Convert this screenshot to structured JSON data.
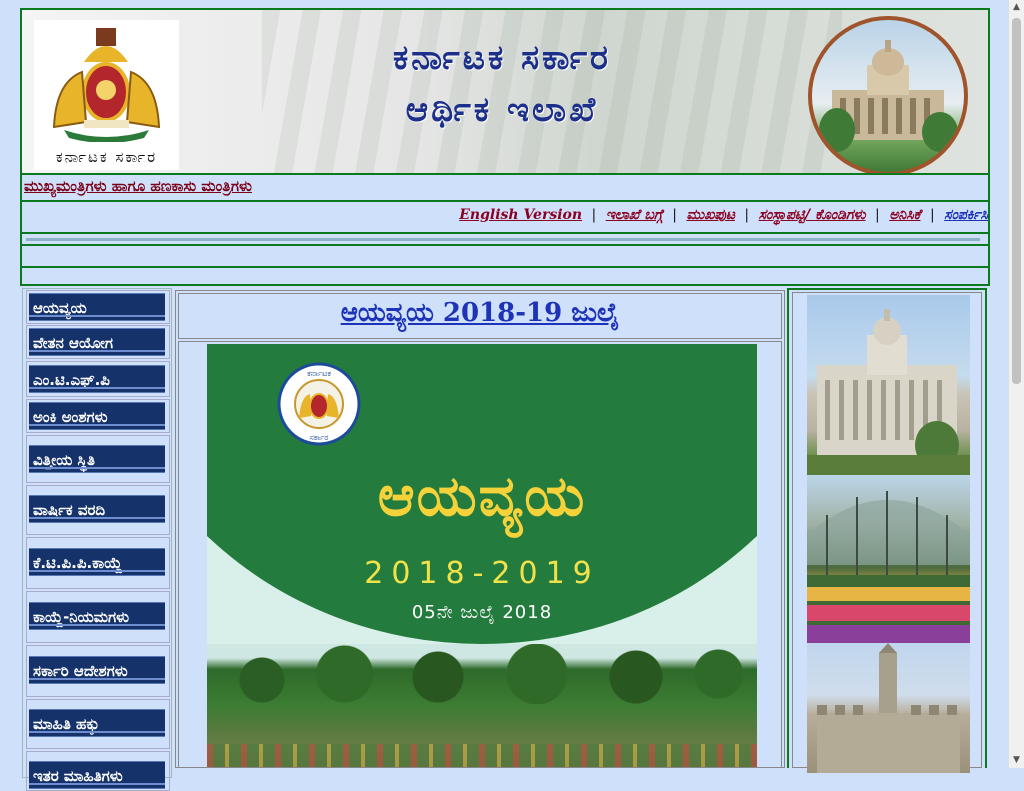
{
  "banner": {
    "emblem_caption": "ಕರ್ನಾಟಕ ಸರ್ಕಾರ",
    "title_line1": "ಕರ್ನಾಟಕ  ಸರ್ಕಾರ",
    "title_line2": "ಆರ್ಥಿಕ ಇಲಾಖೆ"
  },
  "ministers_link": "ಮುಖ್ಯಮಂತ್ರಿಗಳು ಹಾಗೂ ಹಣಕಾಸು ಮಂತ್ರಿಗಳು",
  "nav": {
    "english": "English Version",
    "about": "ಇಲಾಖೆ ಬಗ್ಗೆ",
    "home": "ಮುಖಪುಟ",
    "site_links": "ಸಂಸ್ಥಾಪಟ್ಟಿ/ ಕೊಂಡಿಗಳು",
    "opinion": "ಅನಿಸಿಕೆ",
    "contact": "ಸಂಪರ್ಕಿಸಿ",
    "separator": "|"
  },
  "sidebar": {
    "items": [
      {
        "label": "ಆಯವ್ಯಯ"
      },
      {
        "label": "ವೇತನ ಆಯೋಗ"
      },
      {
        "label": "ಎಂ.ಟಿ.ಎಫ್.ಪಿ"
      },
      {
        "label": "ಅಂಕಿ ಅಂಶಗಳು"
      },
      {
        "label": "ವಿತ್ತೀಯ ಸ್ಥಿತಿ"
      },
      {
        "label": "ವಾರ್ಷಿಕ ವರದಿ"
      },
      {
        "label": "ಕೆ.ಟಿ.ಪಿ.ಪಿ.ಕಾಯ್ದೆ"
      },
      {
        "label": "ಕಾಯ್ದೆ-ನಿಯಮಗಳು"
      },
      {
        "label": "ಸರ್ಕಾರಿ ಆದೇಶಗಳು"
      },
      {
        "label": "ಮಾಹಿತಿ ಹಕ್ಕು"
      },
      {
        "label": "ಇತರ ಮಾಹಿತಿಗಳು"
      }
    ]
  },
  "main": {
    "heading_link": "ಆಯವ್ಯಯ 2018-19 ಜುಲೈ",
    "cover": {
      "title": "ಆಯವ್ಯಯ",
      "years": "2018-2019",
      "date": "05ನೇ ಜುಲೈ 2018",
      "seal_top": "ಕರ್ನಾಟಕ",
      "seal_bottom": "ಸರ್ಕಾರ"
    }
  },
  "colors": {
    "page_bg": "#cfe0fb",
    "border_green": "#0b7a1e",
    "menu_bg": "#15326b",
    "link_maroon": "#8b0020",
    "link_blue": "#1d33b8",
    "cover_green": "#237c3e",
    "cover_yellow": "#f6d23a"
  }
}
